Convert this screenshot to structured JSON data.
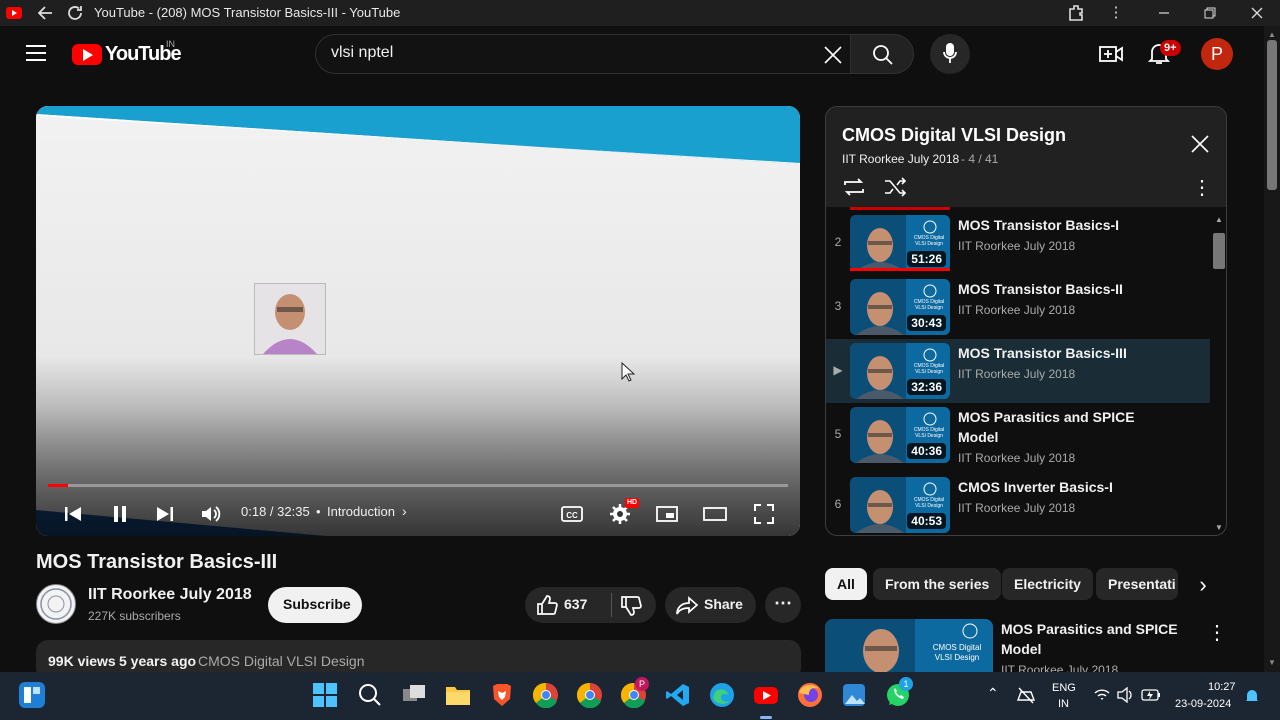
{
  "window": {
    "title": "YouTube - (208) MOS Transistor Basics-III - YouTube"
  },
  "masthead": {
    "logo_text": "YouTube",
    "region": "IN",
    "search_value": "vlsi nptel",
    "notif_count": "9+",
    "avatar_letter": "P"
  },
  "player": {
    "time": "0:18 / 32:35",
    "chapter": "Introduction",
    "hd_badge": "HD",
    "progress_fraction": 0.009
  },
  "playlist": {
    "title": "CMOS Digital VLSI Design",
    "channel": "IIT Roorkee July 2018",
    "position": "- 4 / 41",
    "items": [
      {
        "num": "2",
        "title": "MOS Transistor Basics-I",
        "channel": "IIT Roorkee July 2018",
        "duration": "51:26",
        "active": false
      },
      {
        "num": "3",
        "title": "MOS Transistor Basics-II",
        "channel": "IIT Roorkee July 2018",
        "duration": "30:43",
        "active": false
      },
      {
        "num": "▶",
        "title": "MOS Transistor Basics-III",
        "channel": "IIT Roorkee July 2018",
        "duration": "32:36",
        "active": true
      },
      {
        "num": "5",
        "title": "MOS Parasitics and SPICE Model",
        "channel": "IIT Roorkee July 2018",
        "duration": "40:36",
        "active": false
      },
      {
        "num": "6",
        "title": "CMOS Inverter Basics-I",
        "channel": "IIT Roorkee July 2018",
        "duration": "40:53",
        "active": false
      }
    ]
  },
  "video": {
    "title": "MOS Transistor Basics-III",
    "channel": "IIT Roorkee July 2018",
    "subscribers": "227K subscribers",
    "subscribe_label": "Subscribe",
    "likes": "637",
    "share_label": "Share",
    "views": "99K views",
    "age": "5 years ago",
    "playlist_link": "CMOS Digital VLSI Design"
  },
  "chips": [
    "All",
    "From the series",
    "Electricity",
    "Presentati"
  ],
  "recommended": {
    "title": "MOS Parasitics and SPICE Model",
    "channel": "IIT Roorkee July 2018",
    "thumb_text": "CMOS Digital VLSI Design"
  },
  "thumb_text": "CMOS Digital VLSI Design",
  "taskbar": {
    "lang": "ENG",
    "region": "IN",
    "time": "10:27",
    "date": "23-09-2024",
    "chrome_badge": "P",
    "whatsapp_badge": "1"
  },
  "colors": {
    "accent_red": "#ff0000",
    "avatar": "#c1270f",
    "active_row": "#1a2c36"
  }
}
